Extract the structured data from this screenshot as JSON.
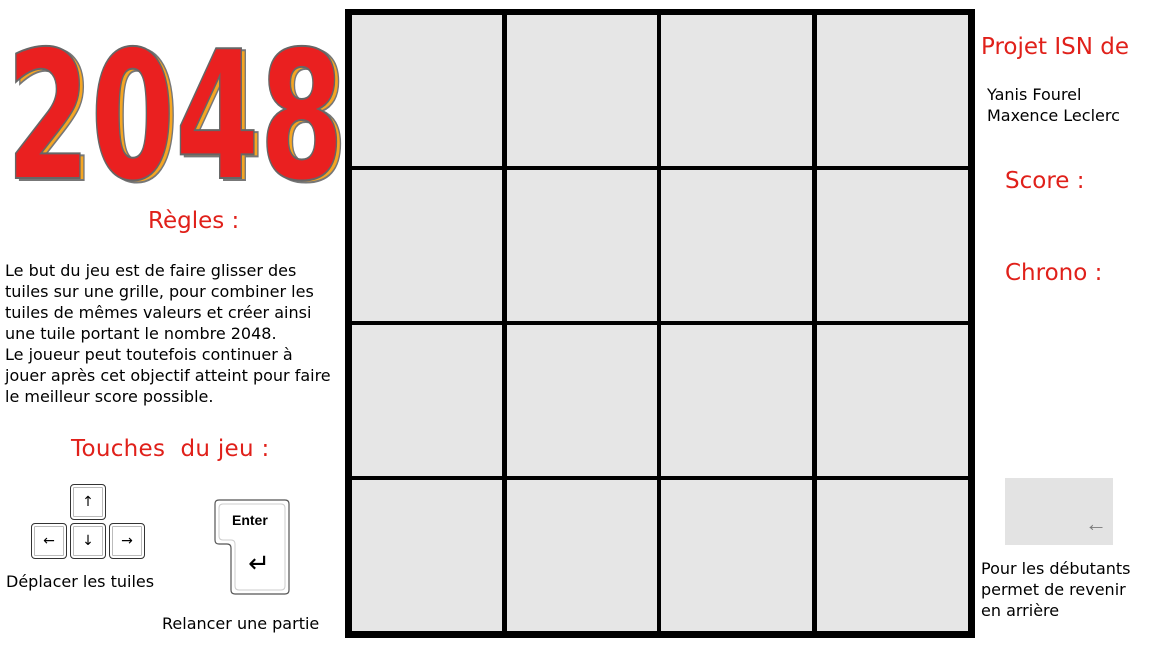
{
  "logo": {
    "text": "2048"
  },
  "rules": {
    "title": "Règles :",
    "text": "Le but du jeu est de faire glisser des tuiles sur une grille, pour combiner les tuiles de mêmes valeurs et créer ainsi une tuile portant le nombre 2048.\nLe joueur peut toutefois continuer à jouer après cet objectif atteint pour faire le meilleur score possible."
  },
  "controls": {
    "title": "Touches  du jeu :",
    "arrow_keys": {
      "up": "↑",
      "left": "←",
      "down": "↓",
      "right": "→"
    },
    "move_label": "Déplacer les tuiles",
    "enter_key": {
      "label": "Enter",
      "symbol": "↵"
    },
    "restart_label": "Relancer une partie"
  },
  "board": {
    "rows": 4,
    "cols": 4,
    "tiles": [
      [
        "",
        "",
        "",
        ""
      ],
      [
        "",
        "",
        "",
        ""
      ],
      [
        "",
        "",
        "",
        ""
      ],
      [
        "",
        "",
        "",
        ""
      ]
    ]
  },
  "sidebar": {
    "project_title": "Projet ISN de",
    "authors": [
      "Yanis Fourel",
      "Maxence Leclerc"
    ],
    "score_label": "Score :",
    "chrono_label": "Chrono :",
    "undo_button": {
      "icon": "←",
      "description": "Pour les débutants\npermet de revenir\nen arrière"
    }
  },
  "colors": {
    "accent": "#e0201a",
    "logo_fill": "#ea2020",
    "logo_shadow": "#f5a623",
    "tile_empty": "#e6e6e6",
    "board_border": "#000000",
    "undo_bg": "#e3e3e3"
  }
}
